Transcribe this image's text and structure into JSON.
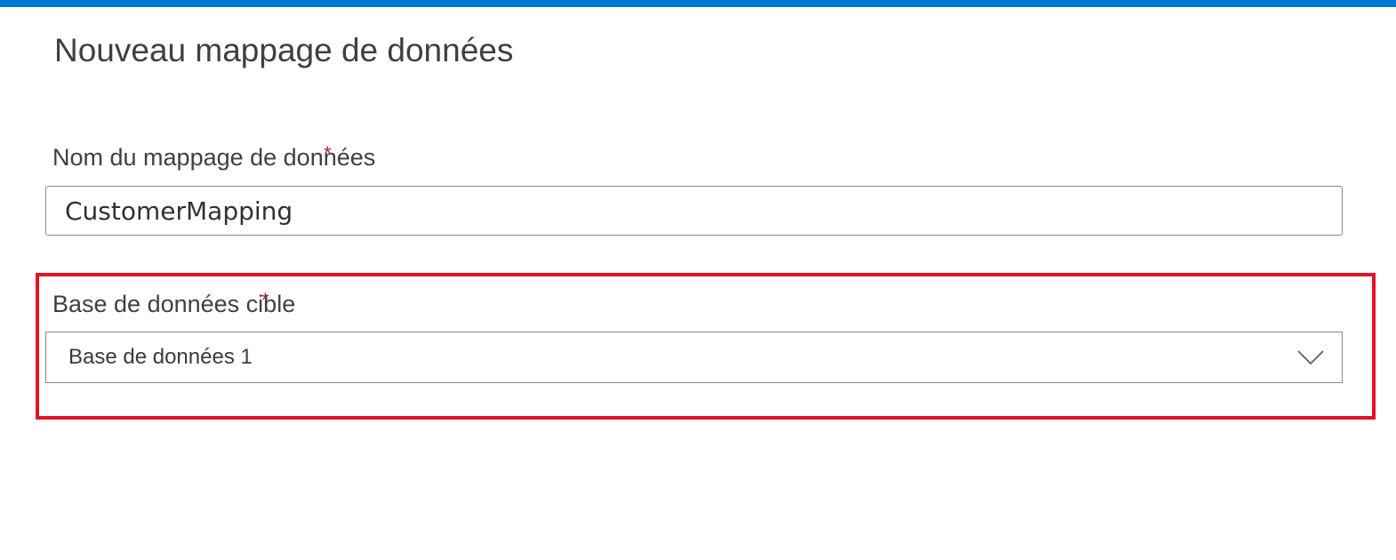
{
  "colors": {
    "top_bar": "#0078d4",
    "highlight": "#e81123",
    "required": "#a4262c"
  },
  "page": {
    "title": "Nouveau mappage de données"
  },
  "form": {
    "name_field": {
      "label": "Nom du mappage de données",
      "required_marker": "*",
      "value": "CustomerMapping"
    },
    "target_db_field": {
      "label": "Base de données cible",
      "required_marker": "*",
      "selected_value": "Base de données 1",
      "icon": "chevron-down-icon"
    }
  }
}
